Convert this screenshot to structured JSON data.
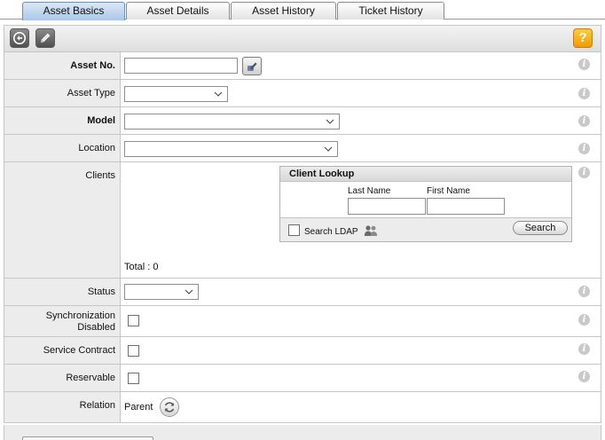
{
  "tabs": [
    {
      "label": "Asset Basics",
      "active": true
    },
    {
      "label": "Asset Details",
      "active": false
    },
    {
      "label": "Asset History",
      "active": false
    },
    {
      "label": "Ticket History",
      "active": false
    }
  ],
  "toolbar": {
    "back_icon": "undo-arrow-icon",
    "edit_icon": "pencil-icon",
    "help_label": "?"
  },
  "form": {
    "asset_no": {
      "label": "Asset No.",
      "value": ""
    },
    "asset_type": {
      "label": "Asset Type",
      "value": ""
    },
    "model": {
      "label": "Model",
      "value": ""
    },
    "location": {
      "label": "Location",
      "value": ""
    },
    "clients": {
      "label": "Clients",
      "total_text": "Total : 0"
    },
    "status": {
      "label": "Status",
      "value": ""
    },
    "sync_disabled": {
      "label_line1": "Synchronization",
      "label_line2": "Disabled"
    },
    "service_contract": {
      "label": "Service Contract"
    },
    "reservable": {
      "label": "Reservable"
    },
    "relation": {
      "label": "Relation",
      "parent_label": "Parent"
    }
  },
  "client_lookup": {
    "title": "Client Lookup",
    "last_name_label": "Last Name",
    "first_name_label": "First Name",
    "last_name_value": "",
    "first_name_value": "",
    "search_ldap_label": "Search LDAP",
    "search_button": "Search"
  },
  "colors": {
    "active_tab": "#a9c6e8",
    "help": "#f39a00",
    "label_bg": "#ececec"
  }
}
